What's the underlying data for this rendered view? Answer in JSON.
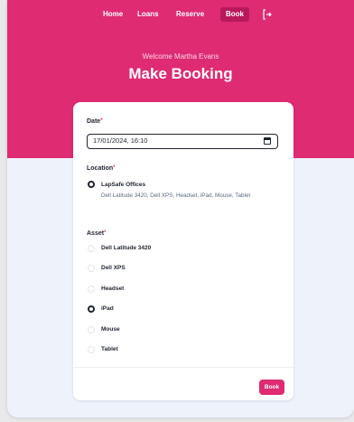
{
  "nav": {
    "items": [
      "Home",
      "Loans",
      "Reserve",
      "Book"
    ],
    "active": "Book",
    "logout_icon": "logout-icon"
  },
  "header": {
    "welcome": "Welcome Martha Evans",
    "title": "Make Booking"
  },
  "form": {
    "date": {
      "label": "Date",
      "required_mark": "*",
      "value": "17/01/2024, 16:10",
      "icon": "calendar-icon"
    },
    "location": {
      "label": "Location",
      "required_mark": "*",
      "options": [
        {
          "label": "LapSafe Offices",
          "description": "Dell Latitude 3420, Dell XPS, Headset, iPad, Mouse, Tablet",
          "selected": true
        }
      ]
    },
    "asset": {
      "label": "Asset",
      "required_mark": "*",
      "options": [
        {
          "label": "Dell Latitude 3420",
          "selected": false
        },
        {
          "label": "Dell XPS",
          "selected": false
        },
        {
          "label": "Headset",
          "selected": false
        },
        {
          "label": "iPad",
          "selected": true
        },
        {
          "label": "Mouse",
          "selected": false
        },
        {
          "label": "Tablet",
          "selected": false
        }
      ]
    },
    "submit_label": "Book"
  },
  "colors": {
    "brand": "#de2b72",
    "text": "#1e2430",
    "muted": "#5b6b86"
  }
}
